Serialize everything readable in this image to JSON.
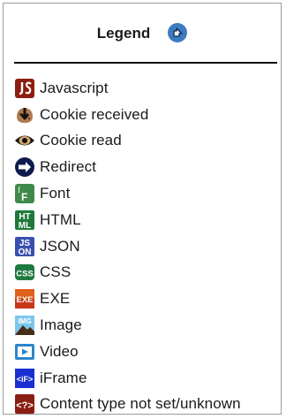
{
  "legend": {
    "title": "Legend",
    "collapse_icon": "collapse-arrow-icon",
    "items": [
      {
        "label": "Javascript",
        "icon": "javascript-icon",
        "color": "#8b1e12"
      },
      {
        "label": "Cookie received",
        "icon": "cookie-received-icon",
        "color": "#b07b4f"
      },
      {
        "label": "Cookie read",
        "icon": "cookie-read-icon",
        "color": "#111111"
      },
      {
        "label": "Redirect",
        "icon": "redirect-icon",
        "color": "#0d1b4d"
      },
      {
        "label": "Font",
        "icon": "font-icon",
        "color": "#3f8a4a"
      },
      {
        "label": "HTML",
        "icon": "html-icon",
        "color": "#1e7a3a"
      },
      {
        "label": "JSON",
        "icon": "json-icon",
        "color": "#3b4fb0"
      },
      {
        "label": "CSS",
        "icon": "css-icon",
        "color": "#1f7a3f"
      },
      {
        "label": "EXE",
        "icon": "exe-icon",
        "color": "#e0601a"
      },
      {
        "label": "Image",
        "icon": "image-icon",
        "color": "#3aa0d8"
      },
      {
        "label": "Video",
        "icon": "video-icon",
        "color": "#2c86c9"
      },
      {
        "label": "iFrame",
        "icon": "iframe-icon",
        "color": "#1a2fd1"
      },
      {
        "label": "Content type not set/unknown",
        "icon": "unknown-icon",
        "color": "#8b1e12"
      }
    ]
  }
}
